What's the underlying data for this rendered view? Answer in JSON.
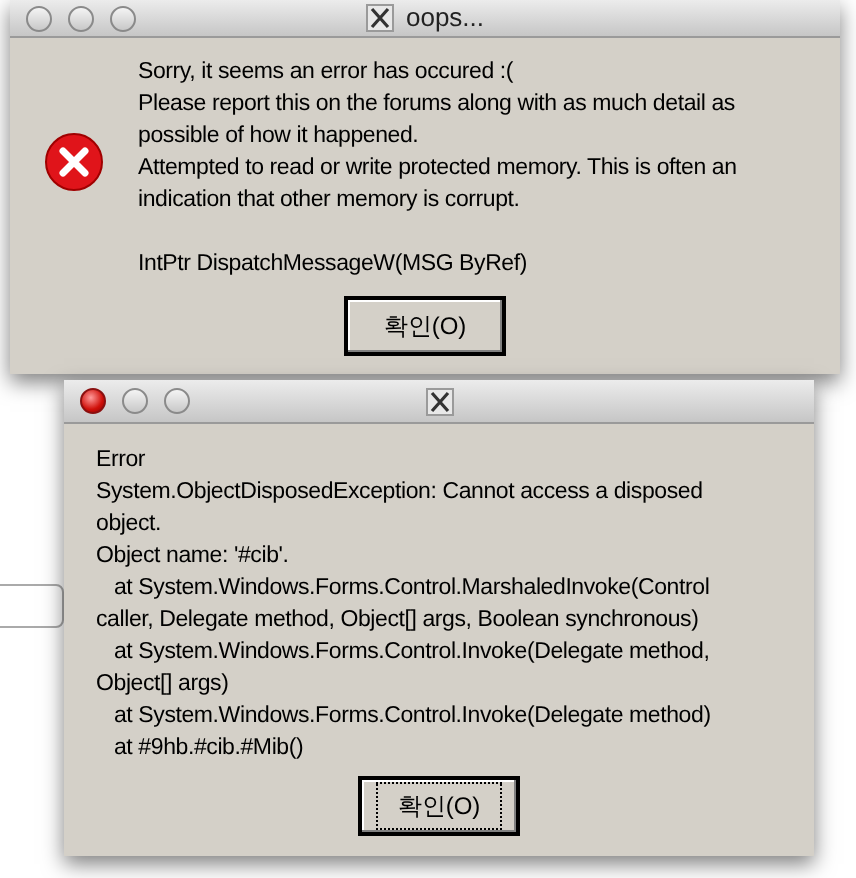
{
  "windows": [
    {
      "title": "oops...",
      "active": false,
      "blocks": [
        [
          "Sorry, it seems an error has occured :(",
          "Please report this on the forums along with as much detail as",
          "possible of how it happened.",
          "Attempted to read or write protected memory. This is often an",
          "indication that other memory is corrupt."
        ],
        [
          "IntPtr DispatchMessageW(MSG ByRef)"
        ]
      ],
      "button": {
        "label": "확인(O)",
        "focused": false
      }
    },
    {
      "active": true,
      "blocks": [
        [
          "Error",
          "System.ObjectDisposedException: Cannot access a disposed",
          "object.",
          "Object name: '#cib'.",
          "   at System.Windows.Forms.Control.MarshaledInvoke(Control",
          "caller, Delegate method, Object[] args, Boolean synchronous)",
          "   at System.Windows.Forms.Control.Invoke(Delegate method,",
          "Object[] args)",
          "   at System.Windows.Forms.Control.Invoke(Delegate method)",
          "   at #9hb.#cib.#Mib()"
        ]
      ],
      "button": {
        "label": "확인(O)",
        "focused": true
      }
    }
  ]
}
